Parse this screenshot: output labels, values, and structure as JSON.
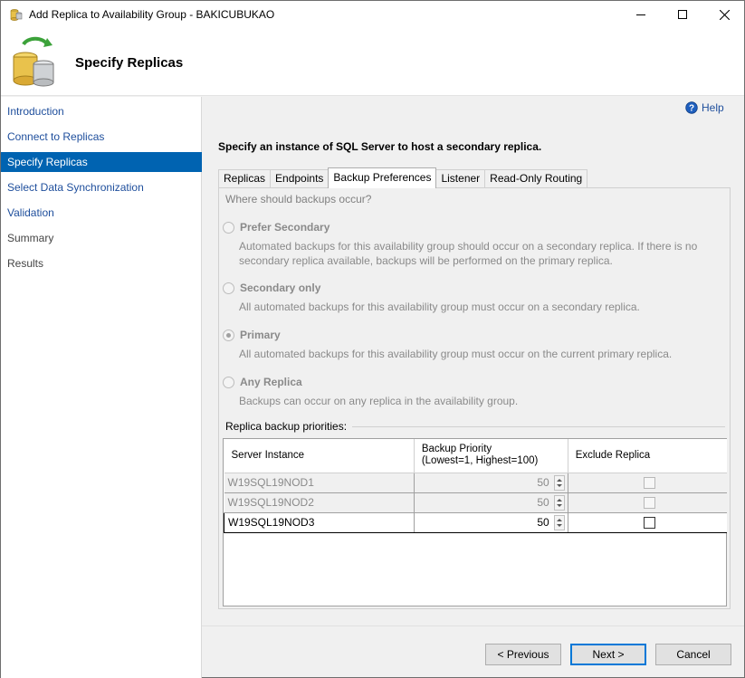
{
  "window": {
    "title": "Add Replica to Availability Group - BAKICUBUKAO"
  },
  "header": {
    "heading": "Specify Replicas"
  },
  "sidebar": {
    "items": [
      {
        "label": "Introduction",
        "state": "link"
      },
      {
        "label": "Connect to Replicas",
        "state": "link"
      },
      {
        "label": "Specify Replicas",
        "state": "active"
      },
      {
        "label": "Select Data Synchronization",
        "state": "link"
      },
      {
        "label": "Validation",
        "state": "link"
      },
      {
        "label": "Summary",
        "state": "disabled"
      },
      {
        "label": "Results",
        "state": "disabled"
      }
    ]
  },
  "help": {
    "label": "Help"
  },
  "main": {
    "instruction": "Specify an instance of SQL Server to host a secondary replica.",
    "tabs": [
      {
        "label": "Replicas",
        "active": false
      },
      {
        "label": "Endpoints",
        "active": false
      },
      {
        "label": "Backup Preferences",
        "active": true
      },
      {
        "label": "Listener",
        "active": false
      },
      {
        "label": "Read-Only Routing",
        "active": false
      }
    ],
    "backup": {
      "question": "Where should backups occur?",
      "selected": "Primary",
      "options": [
        {
          "label": "Prefer Secondary",
          "description": "Automated backups for this availability group should occur on a secondary replica. If there is no secondary replica available, backups will be performed on the primary replica."
        },
        {
          "label": "Secondary only",
          "description": "All automated backups for this availability group must occur on a secondary replica."
        },
        {
          "label": "Primary",
          "description": "All automated backups for this availability group must occur on the current primary replica."
        },
        {
          "label": "Any Replica",
          "description": "Backups can occur on any replica in the availability group."
        }
      ]
    },
    "priorities": {
      "legend": "Replica backup priorities:",
      "columns": {
        "server": "Server Instance",
        "priority_line1": "Backup Priority",
        "priority_line2": "(Lowest=1, Highest=100)",
        "exclude": "Exclude Replica"
      },
      "rows": [
        {
          "server": "W19SQL19NOD1",
          "priority": "50",
          "exclude": false,
          "enabled": false
        },
        {
          "server": "W19SQL19NOD2",
          "priority": "50",
          "exclude": false,
          "enabled": false
        },
        {
          "server": "W19SQL19NOD3",
          "priority": "50",
          "exclude": false,
          "enabled": true
        }
      ]
    }
  },
  "footer": {
    "previous": "< Previous",
    "next": "Next >",
    "cancel": "Cancel"
  }
}
